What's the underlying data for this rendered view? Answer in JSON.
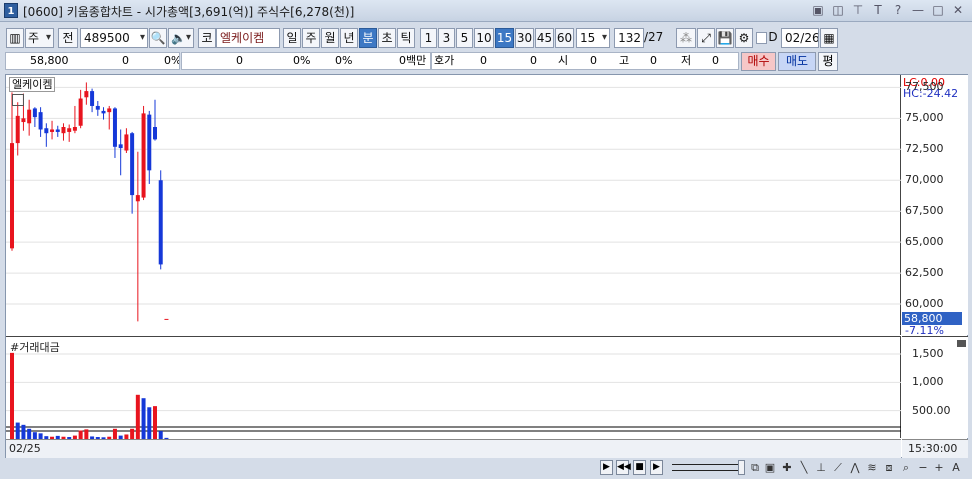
{
  "window": {
    "app_icon": "1",
    "title": "[0600] 키움종합차트 - 시가총액[3,691(억)] 주식수[6,278(천)]",
    "buttons": [
      "▣",
      "◫",
      "⊤",
      "T",
      "?",
      "—",
      "□",
      "✕"
    ]
  },
  "toolbar": {
    "period_type": "주",
    "scope": "전",
    "code": "489500",
    "market": "코",
    "stock_name": "엘케이켐",
    "periods": [
      "일",
      "주",
      "월",
      "년",
      "분",
      "초",
      "틱"
    ],
    "selected_period": "분",
    "intervals": [
      "1",
      "3",
      "5",
      "10",
      "15",
      "30",
      "45",
      "60"
    ],
    "selected_interval": "15",
    "interval_value": "15",
    "count": "132",
    "count_total": "/27",
    "date_flag": "D",
    "date": "02/26"
  },
  "quote": {
    "price": "58,800",
    "change": "0",
    "change_rate": "0%",
    "v1": "0",
    "v1_pct": "0%",
    "v2_pct": "0%",
    "amount_unit": "0백만",
    "hoga_label": "호가",
    "hoga_value": "0",
    "hoga_value2": "0",
    "open_label": "시",
    "open_value": "0",
    "high_label": "고",
    "high_value": "0",
    "low_label": "저",
    "low_value": "0",
    "buy_label": "매수",
    "sell_label": "매도",
    "eval_label": "평"
  },
  "chart": {
    "stock_tag": "엘케이켐",
    "lc_label": "LC:0.00",
    "hc_label": "HC:-24.42",
    "current_price": "58,800",
    "current_pct": "-7.11%",
    "price_ticks": [
      "77,500",
      "75,000",
      "72,500",
      "70,000",
      "67,500",
      "65,000",
      "62,500",
      "60,000"
    ],
    "volume_title": "#거래대금",
    "volume_ticks": [
      "1,500",
      "1,000",
      "500.00"
    ],
    "x_label": "02/25",
    "time_label": "15:30:00"
  },
  "colors": {
    "up": "#e8141e",
    "down": "#1538d8",
    "axis_red": "#e00000",
    "axis_blue": "#2030c0",
    "highlight": "#2f62c4"
  },
  "chart_data": {
    "type": "candlestick",
    "ylim": [
      57500,
      78500
    ],
    "candles": [
      {
        "o": 64500,
        "h": 77100,
        "l": 64300,
        "c": 73000
      },
      {
        "o": 73000,
        "h": 76300,
        "l": 72000,
        "c": 75200
      },
      {
        "o": 74700,
        "h": 77000,
        "l": 74000,
        "c": 75000
      },
      {
        "o": 74600,
        "h": 76500,
        "l": 73600,
        "c": 75700
      },
      {
        "o": 75800,
        "h": 75900,
        "l": 74300,
        "c": 75100
      },
      {
        "o": 75500,
        "h": 75900,
        "l": 73500,
        "c": 74100
      },
      {
        "o": 74200,
        "h": 74600,
        "l": 72700,
        "c": 73800
      },
      {
        "o": 73900,
        "h": 74800,
        "l": 73300,
        "c": 74100
      },
      {
        "o": 74100,
        "h": 74400,
        "l": 73500,
        "c": 73900
      },
      {
        "o": 73800,
        "h": 74600,
        "l": 73200,
        "c": 74300
      },
      {
        "o": 73900,
        "h": 74500,
        "l": 73100,
        "c": 74200
      },
      {
        "o": 74000,
        "h": 76000,
        "l": 73800,
        "c": 74300
      },
      {
        "o": 74400,
        "h": 77300,
        "l": 74200,
        "c": 76600
      },
      {
        "o": 76700,
        "h": 77900,
        "l": 76100,
        "c": 77200
      },
      {
        "o": 77200,
        "h": 77400,
        "l": 75500,
        "c": 76000
      },
      {
        "o": 76000,
        "h": 76400,
        "l": 75200,
        "c": 75700
      },
      {
        "o": 75600,
        "h": 75900,
        "l": 74900,
        "c": 75400
      },
      {
        "o": 75500,
        "h": 76000,
        "l": 74100,
        "c": 75800
      },
      {
        "o": 75800,
        "h": 75900,
        "l": 71800,
        "c": 72700
      },
      {
        "o": 72900,
        "h": 74100,
        "l": 70400,
        "c": 72600
      },
      {
        "o": 72400,
        "h": 74200,
        "l": 72200,
        "c": 73700
      },
      {
        "o": 73800,
        "h": 73900,
        "l": 67300,
        "c": 68800
      },
      {
        "o": 68300,
        "h": 72300,
        "l": 58600,
        "c": 68800
      },
      {
        "o": 68600,
        "h": 76000,
        "l": 68400,
        "c": 75400
      },
      {
        "o": 75300,
        "h": 75600,
        "l": 69700,
        "c": 70800
      },
      {
        "o": 74300,
        "h": 76500,
        "l": 73200,
        "c": 73300
      },
      {
        "o": 70000,
        "h": 70800,
        "l": 62800,
        "c": 63200
      },
      {
        "o": 58800,
        "h": 58800,
        "l": 58800,
        "c": 58800
      }
    ],
    "volume": {
      "ylim": [
        0,
        1800
      ],
      "values": [
        1520,
        290,
        250,
        180,
        120,
        100,
        50,
        40,
        55,
        40,
        35,
        60,
        150,
        170,
        45,
        35,
        30,
        40,
        180,
        60,
        80,
        180,
        780,
        720,
        560,
        580,
        140,
        20
      ],
      "up": [
        true,
        false,
        false,
        false,
        false,
        false,
        false,
        true,
        false,
        true,
        false,
        true,
        true,
        true,
        false,
        false,
        false,
        true,
        true,
        false,
        true,
        true,
        true,
        false,
        false,
        true,
        false,
        false
      ]
    }
  }
}
